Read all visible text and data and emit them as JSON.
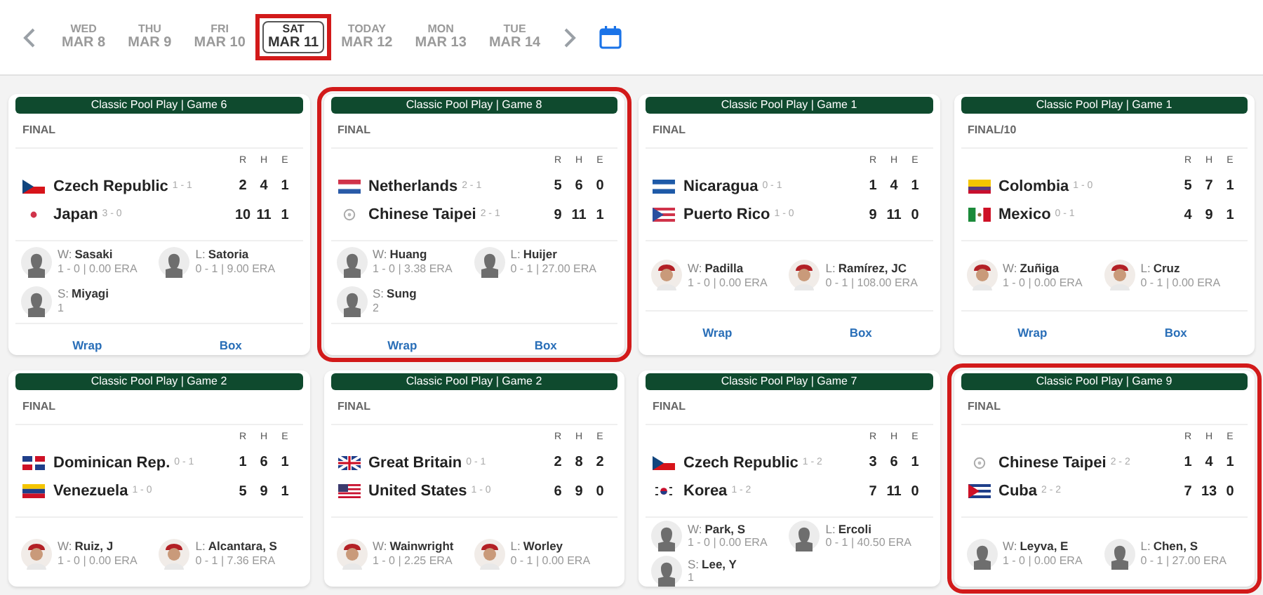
{
  "dates": [
    {
      "day": "WED",
      "date": "MAR 8",
      "selected": false,
      "highlighted": false
    },
    {
      "day": "THU",
      "date": "MAR 9",
      "selected": false,
      "highlighted": false
    },
    {
      "day": "FRI",
      "date": "MAR 10",
      "selected": false,
      "highlighted": false
    },
    {
      "day": "SAT",
      "date": "MAR 11",
      "selected": true,
      "highlighted": true
    },
    {
      "day": "TODAY",
      "date": "MAR 12",
      "selected": false,
      "highlighted": false
    },
    {
      "day": "MON",
      "date": "MAR 13",
      "selected": false,
      "highlighted": false
    },
    {
      "day": "TUE",
      "date": "MAR 14",
      "selected": false,
      "highlighted": false
    }
  ],
  "games": [
    {
      "label": "Classic Pool Play | Game 6",
      "status": "FINAL",
      "highlighted": false,
      "columns": [
        "R",
        "H",
        "E"
      ],
      "teams": [
        {
          "kind": "czech",
          "name": "Czech Republic",
          "record": "1 - 1",
          "r": "2",
          "h": "4",
          "e": "1"
        },
        {
          "kind": "japan",
          "name": "Japan",
          "record": "3 - 0",
          "r": "10",
          "h": "11",
          "e": "1"
        }
      ],
      "pitchers": [
        {
          "kind": "silhouette",
          "role": "W:",
          "name": "Sasaki",
          "line": "1 - 0 | 0.00 ERA"
        },
        {
          "kind": "silhouette",
          "role": "L:",
          "name": "Satoria",
          "line": "0 - 1 | 9.00 ERA"
        },
        {
          "kind": "silhouette",
          "role": "S:",
          "name": "Miyagi",
          "line": "1"
        }
      ],
      "links": [
        "Wrap",
        "Box"
      ]
    },
    {
      "label": "Classic Pool Play | Game 8",
      "status": "FINAL",
      "highlighted": true,
      "columns": [
        "R",
        "H",
        "E"
      ],
      "teams": [
        {
          "kind": "netherlands",
          "name": "Netherlands",
          "record": "2 - 1",
          "r": "5",
          "h": "6",
          "e": "0"
        },
        {
          "kind": "taipei",
          "name": "Chinese Taipei",
          "record": "2 - 1",
          "r": "9",
          "h": "11",
          "e": "1"
        }
      ],
      "pitchers": [
        {
          "kind": "silhouette",
          "role": "W:",
          "name": "Huang",
          "line": "1 - 0 | 3.38 ERA"
        },
        {
          "kind": "silhouette",
          "role": "L:",
          "name": "Huijer",
          "line": "0 - 1 | 27.00 ERA"
        },
        {
          "kind": "silhouette",
          "role": "S:",
          "name": "Sung",
          "line": "2"
        }
      ],
      "links": [
        "Wrap",
        "Box"
      ]
    },
    {
      "label": "Classic Pool Play | Game 1",
      "status": "FINAL",
      "highlighted": false,
      "columns": [
        "R",
        "H",
        "E"
      ],
      "teams": [
        {
          "kind": "nicaragua",
          "name": "Nicaragua",
          "record": "0 - 1",
          "r": "1",
          "h": "4",
          "e": "1"
        },
        {
          "kind": "puerto_rico",
          "name": "Puerto Rico",
          "record": "1 - 0",
          "r": "9",
          "h": "11",
          "e": "0"
        }
      ],
      "pitchers": [
        {
          "kind": "photo",
          "role": "W:",
          "name": "Padilla",
          "line": "1 - 0 | 0.00 ERA"
        },
        {
          "kind": "photo",
          "role": "L:",
          "name": "Ramírez, JC",
          "line": "0 - 1 | 108.00 ERA"
        }
      ],
      "links": [
        "Wrap",
        "Box"
      ]
    },
    {
      "label": "Classic Pool Play | Game 1",
      "status": "FINAL/10",
      "highlighted": false,
      "columns": [
        "R",
        "H",
        "E"
      ],
      "teams": [
        {
          "kind": "colombia",
          "name": "Colombia",
          "record": "1 - 0",
          "r": "5",
          "h": "7",
          "e": "1"
        },
        {
          "kind": "mexico",
          "name": "Mexico",
          "record": "0 - 1",
          "r": "4",
          "h": "9",
          "e": "1"
        }
      ],
      "pitchers": [
        {
          "kind": "photo",
          "role": "W:",
          "name": "Zuñiga",
          "line": "1 - 0 | 0.00 ERA"
        },
        {
          "kind": "photo",
          "role": "L:",
          "name": "Cruz",
          "line": "0 - 1 | 0.00 ERA"
        }
      ],
      "links": [
        "Wrap",
        "Box"
      ]
    },
    {
      "label": "Classic Pool Play | Game 2",
      "status": "FINAL",
      "highlighted": false,
      "columns": [
        "R",
        "H",
        "E"
      ],
      "teams": [
        {
          "kind": "dominican",
          "name": "Dominican Rep.",
          "record": "0 - 1",
          "r": "1",
          "h": "6",
          "e": "1"
        },
        {
          "kind": "venezuela",
          "name": "Venezuela",
          "record": "1 - 0",
          "r": "5",
          "h": "9",
          "e": "1"
        }
      ],
      "pitchers": [
        {
          "kind": "photo",
          "role": "W:",
          "name": "Ruiz, J",
          "line": "1 - 0 | 0.00 ERA"
        },
        {
          "kind": "photo",
          "role": "L:",
          "name": "Alcantara, S",
          "line": "0 - 1 | 7.36 ERA"
        }
      ]
    },
    {
      "label": "Classic Pool Play | Game 2",
      "status": "FINAL",
      "highlighted": false,
      "columns": [
        "R",
        "H",
        "E"
      ],
      "teams": [
        {
          "kind": "great_britain",
          "name": "Great Britain",
          "record": "0 - 1",
          "r": "2",
          "h": "8",
          "e": "2"
        },
        {
          "kind": "usa",
          "name": "United States",
          "record": "1 - 0",
          "r": "6",
          "h": "9",
          "e": "0"
        }
      ],
      "pitchers": [
        {
          "kind": "photo",
          "role": "W:",
          "name": "Wainwright",
          "line": "1 - 0 | 2.25 ERA"
        },
        {
          "kind": "photo",
          "role": "L:",
          "name": "Worley",
          "line": "0 - 1 | 0.00 ERA"
        }
      ]
    },
    {
      "label": "Classic Pool Play | Game 7",
      "status": "FINAL",
      "highlighted": false,
      "columns": [
        "R",
        "H",
        "E"
      ],
      "teams": [
        {
          "kind": "czech",
          "name": "Czech Republic",
          "record": "1 - 2",
          "r": "3",
          "h": "6",
          "e": "1"
        },
        {
          "kind": "korea",
          "name": "Korea",
          "record": "1 - 2",
          "r": "7",
          "h": "11",
          "e": "0"
        }
      ],
      "pitchers": [
        {
          "kind": "silhouette",
          "role": "W:",
          "name": "Park, S",
          "line": "1 - 0 | 0.00 ERA"
        },
        {
          "kind": "silhouette",
          "role": "L:",
          "name": "Ercoli",
          "line": "0 - 1 | 40.50 ERA"
        },
        {
          "kind": "silhouette",
          "role": "S:",
          "name": "Lee, Y",
          "line": "1"
        }
      ]
    },
    {
      "label": "Classic Pool Play | Game 9",
      "status": "FINAL",
      "highlighted": true,
      "columns": [
        "R",
        "H",
        "E"
      ],
      "teams": [
        {
          "kind": "taipei",
          "name": "Chinese Taipei",
          "record": "2 - 2",
          "r": "1",
          "h": "4",
          "e": "1"
        },
        {
          "kind": "cuba",
          "name": "Cuba",
          "record": "2 - 2",
          "r": "7",
          "h": "13",
          "e": "0"
        }
      ],
      "pitchers": [
        {
          "kind": "silhouette",
          "role": "W:",
          "name": "Leyva, E",
          "line": "1 - 0 | 0.00 ERA"
        },
        {
          "kind": "silhouette",
          "role": "L:",
          "name": "Chen, S",
          "line": "0 - 1 | 27.00 ERA"
        }
      ]
    }
  ]
}
